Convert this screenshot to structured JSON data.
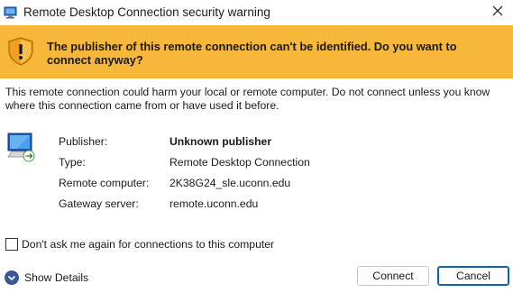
{
  "window": {
    "title": "Remote Desktop Connection security warning"
  },
  "banner": {
    "message": "The publisher of this remote connection can't be identified. Do you want to connect anyway?",
    "color": "#f7b73a"
  },
  "warning_text": "This remote connection could harm your local or remote computer. Do not connect unless you know where this connection came from or have used it before.",
  "details": [
    {
      "label": "Publisher:",
      "value": "Unknown publisher",
      "bold": true
    },
    {
      "label": "Type:",
      "value": "Remote Desktop Connection",
      "bold": false
    },
    {
      "label": "Remote computer:",
      "value": "2K38G24_sle.uconn.edu",
      "bold": false
    },
    {
      "label": "Gateway server:",
      "value": "remote.uconn.edu",
      "bold": false
    }
  ],
  "checkbox": {
    "label": "Don't ask me again for connections to this computer",
    "checked": false
  },
  "show_details_label": "Show Details",
  "buttons": {
    "connect": "Connect",
    "cancel": "Cancel"
  },
  "icons": {
    "title": "remote-desktop-icon",
    "close": "close-icon",
    "warning": "warning-shield-icon",
    "computer": "remote-computer-icon",
    "expand": "chevron-down-circle-icon"
  },
  "accent_color": "#0f62b5"
}
